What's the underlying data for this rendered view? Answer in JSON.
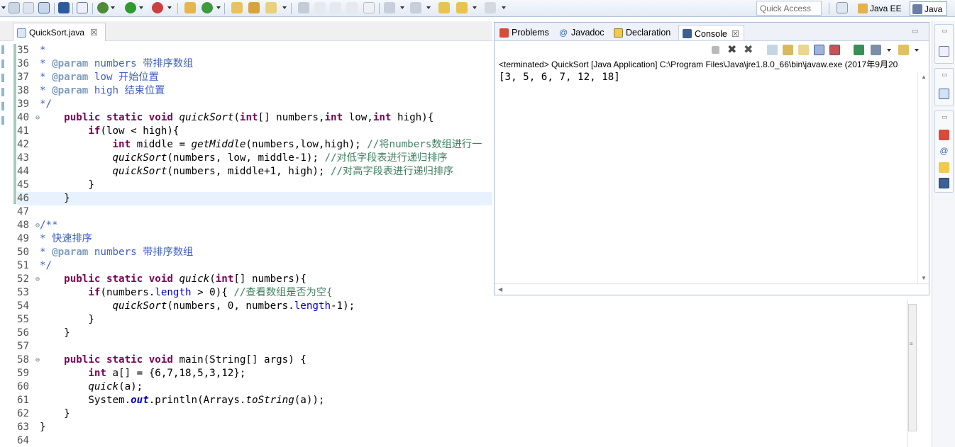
{
  "toolbar": {
    "quick_access_placeholder": "Quick Access",
    "perspectives": [
      {
        "label": "Java EE",
        "active": false
      },
      {
        "label": "Java",
        "active": true
      }
    ]
  },
  "editor": {
    "tab_title": "QuickSort.java",
    "tab_close": "☒",
    "current_line": "46",
    "lines": [
      {
        "num": "35",
        "text": "*",
        "style": "doc"
      },
      {
        "num": "36",
        "text": "* @param numbers 带排序数组",
        "style": "doc"
      },
      {
        "num": "37",
        "text": "* @param low 开始位置",
        "style": "doc"
      },
      {
        "num": "38",
        "text": "* @param high 结束位置",
        "style": "doc"
      },
      {
        "num": "39",
        "text": "*/",
        "style": "doc"
      },
      {
        "num": "40",
        "text": "    public static void quickSort(int[] numbers,int low,int high){",
        "style": "code",
        "fold": "⊖"
      },
      {
        "num": "41",
        "text": "        if(low < high){",
        "style": "code"
      },
      {
        "num": "42",
        "text": "            int middle = getMiddle(numbers,low,high); //将numbers数组进行一",
        "style": "code"
      },
      {
        "num": "43",
        "text": "            quickSort(numbers, low, middle-1); //对低字段表进行递归排序",
        "style": "code"
      },
      {
        "num": "44",
        "text": "            quickSort(numbers, middle+1, high); //对高字段表进行递归排序",
        "style": "code"
      },
      {
        "num": "45",
        "text": "        }",
        "style": "code"
      },
      {
        "num": "46",
        "text": "    }",
        "style": "code"
      },
      {
        "num": "47",
        "text": "",
        "style": "code"
      },
      {
        "num": "48",
        "text": "/**",
        "style": "doc",
        "fold": "⊖"
      },
      {
        "num": "49",
        "text": "* 快速排序",
        "style": "doc"
      },
      {
        "num": "50",
        "text": "* @param numbers 带排序数组",
        "style": "doc"
      },
      {
        "num": "51",
        "text": "*/",
        "style": "doc"
      },
      {
        "num": "52",
        "text": "    public static void quick(int[] numbers){",
        "style": "code",
        "fold": "⊖"
      },
      {
        "num": "53",
        "text": "        if(numbers.length > 0){ //查看数组是否为空{",
        "style": "code"
      },
      {
        "num": "54",
        "text": "            quickSort(numbers, 0, numbers.length-1);",
        "style": "code"
      },
      {
        "num": "55",
        "text": "        }",
        "style": "code"
      },
      {
        "num": "56",
        "text": "    }",
        "style": "code"
      },
      {
        "num": "57",
        "text": "",
        "style": "code"
      },
      {
        "num": "58",
        "text": "    public static void main(String[] args) {",
        "style": "code",
        "fold": "⊖"
      },
      {
        "num": "59",
        "text": "        int a[] = {6,7,18,5,3,12};",
        "style": "code"
      },
      {
        "num": "60",
        "text": "        quick(a);",
        "style": "code"
      },
      {
        "num": "61",
        "text": "        System.out.println(Arrays.toString(a));",
        "style": "code"
      },
      {
        "num": "62",
        "text": "    }",
        "style": "code"
      },
      {
        "num": "63",
        "text": "}",
        "style": "code"
      },
      {
        "num": "64",
        "text": "",
        "style": "code"
      }
    ]
  },
  "console_view": {
    "tabs": [
      {
        "label": "Problems",
        "active": false,
        "icon": "problems-icon"
      },
      {
        "label": "Javadoc",
        "active": false,
        "icon": "javadoc-icon"
      },
      {
        "label": "Declaration",
        "active": false,
        "icon": "declaration-icon"
      },
      {
        "label": "Console",
        "active": true,
        "icon": "console-icon"
      }
    ],
    "tab_close": "☒",
    "status": "<terminated> QuickSort [Java Application] C:\\Program Files\\Java\\jre1.8.0_66\\bin\\javaw.exe (2017年9月20",
    "output": "[3, 5, 6, 7, 12, 18]"
  },
  "colors": {
    "keyword": "#7f0055",
    "comment": "#3f7f5f",
    "javadoc": "#3f5fbf",
    "field": "#0000c0",
    "current_line_bg": "#e8f2fe"
  }
}
